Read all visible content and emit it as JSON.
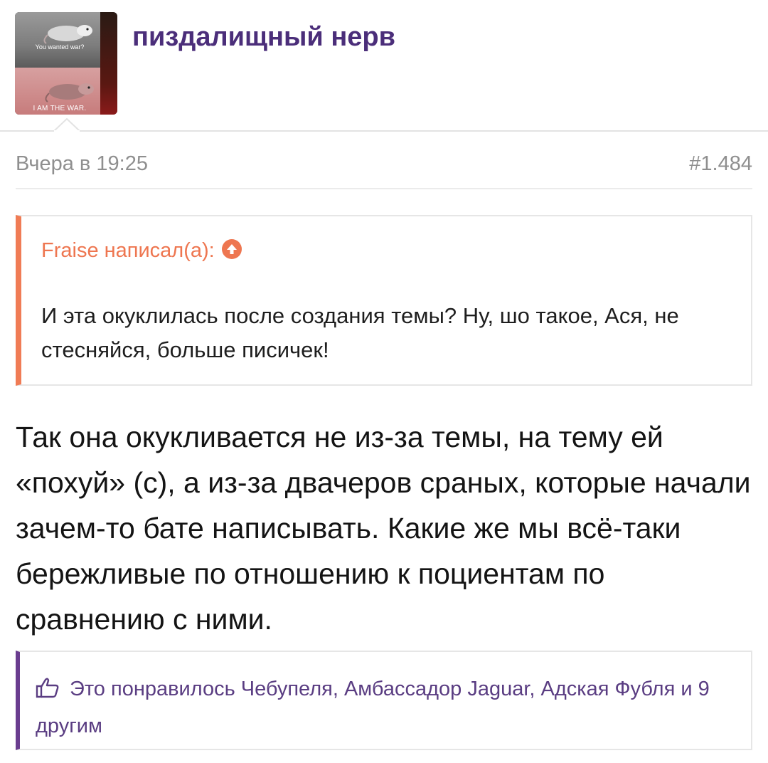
{
  "header": {
    "username": "пиздалищный нерв",
    "avatar": {
      "caption_top": "You wanted war?",
      "caption_bottom": "I AM THE WAR."
    }
  },
  "post": {
    "date": "Вчера в 19:25",
    "number": "#1.484",
    "quote": {
      "author_line": "Fraise написал(а):",
      "text": "И эта окуклилась после создания темы? Ну, шо такое, Ася, не стесняйся, больше писичек!"
    },
    "body": "Так она окукливается не из-за темы, на тему ей «похуй» (с), а из-за двачеров сраных, которые начали зачем-то бате написывать. Какие же мы всё-таки бережливые по отношению к поциентам по сравнению с ними.",
    "likes": "Это понравилось Чебупеля, Амбассадор Jaguar, Адская Фубля и 9 другим"
  },
  "colors": {
    "username": "#4b2e7a",
    "quote_accent": "#f07c55",
    "likes_accent": "#6a3d8f",
    "meta_text": "#8f8f8f"
  },
  "icons": {
    "quote_jump": "arrow-up-circle-icon",
    "likes": "thumbs-up-icon"
  }
}
